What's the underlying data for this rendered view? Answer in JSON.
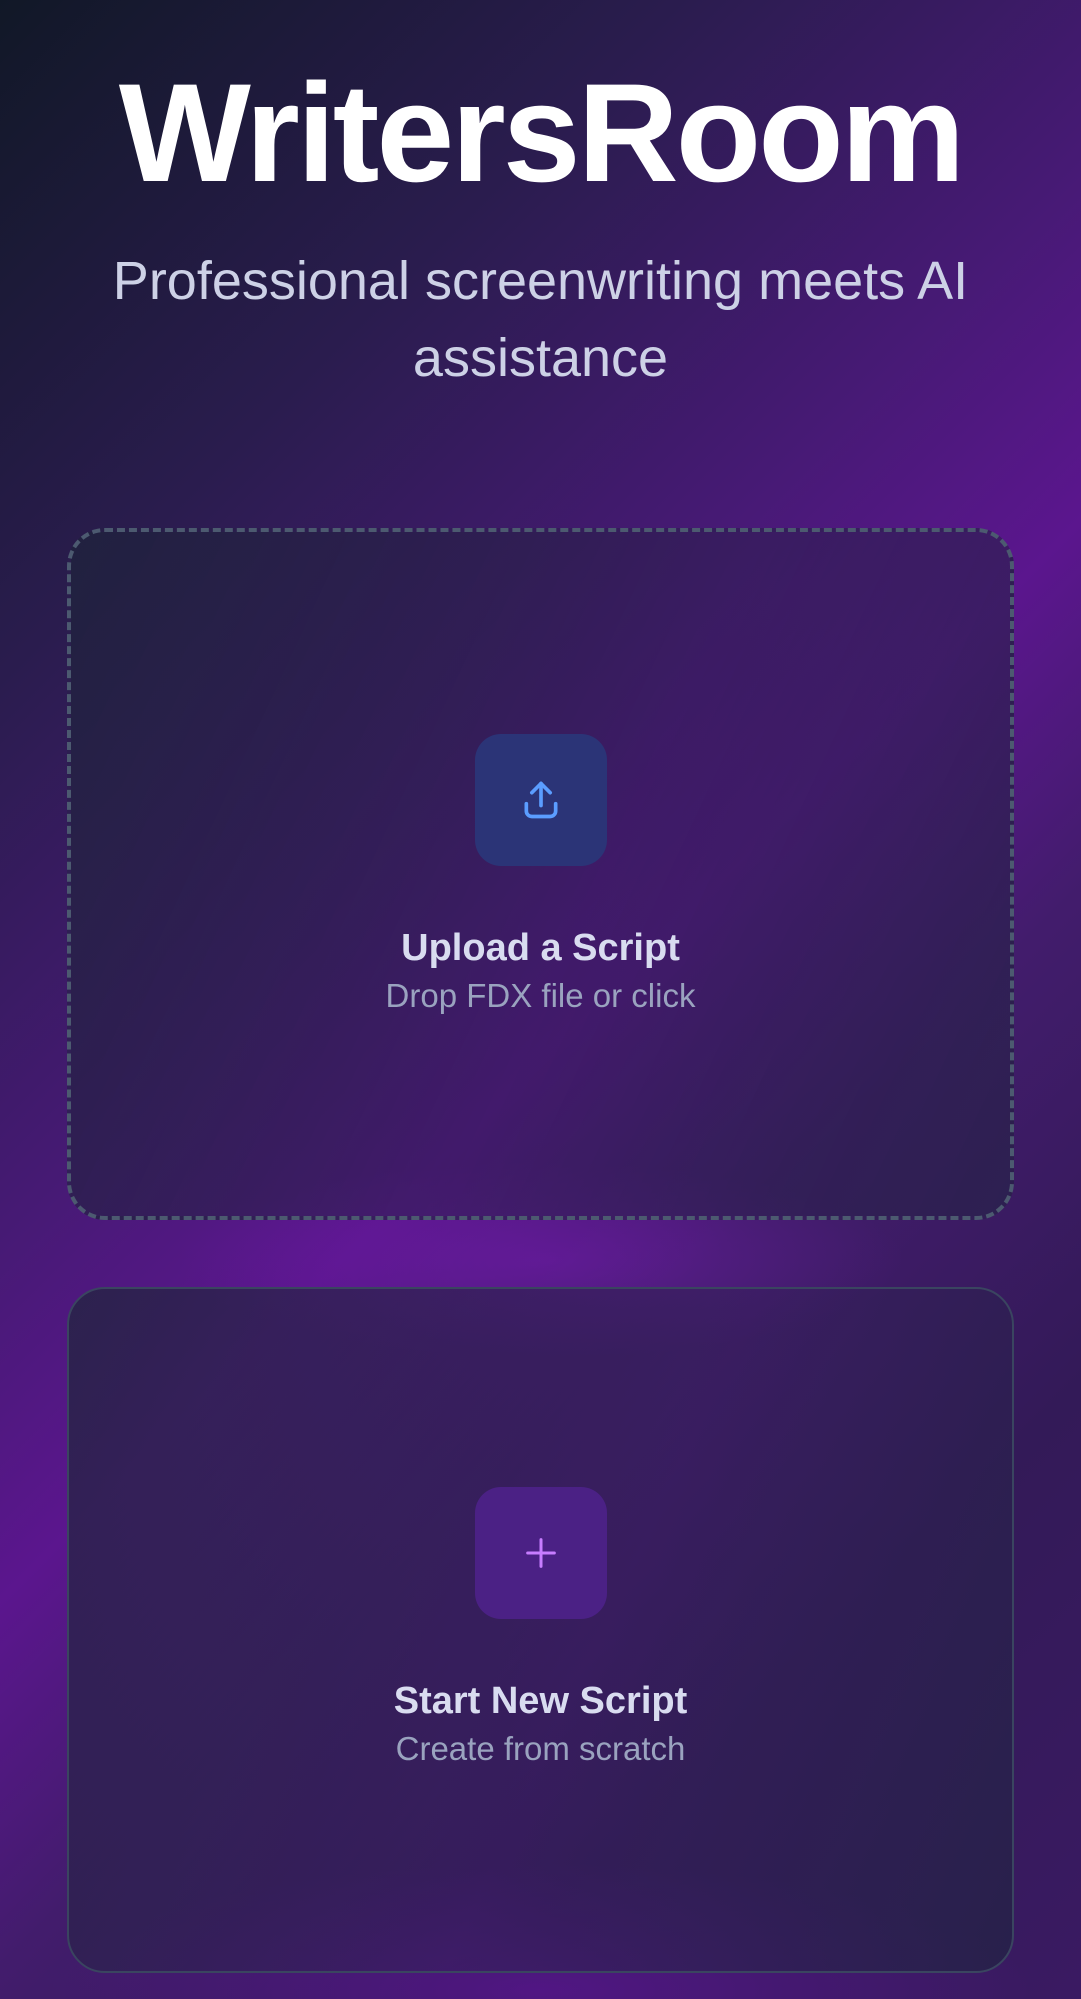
{
  "app": {
    "title": "WritersRoom",
    "tagline": "Professional screenwriting meets AI assistance"
  },
  "cards": {
    "upload": {
      "icon": "upload-icon",
      "title": "Upload a Script",
      "subtitle": "Drop FDX file or click",
      "accent": "#5b9dff"
    },
    "new_script": {
      "icon": "plus-icon",
      "title": "Start New Script",
      "subtitle": "Create from scratch",
      "accent": "#c77dff"
    }
  }
}
